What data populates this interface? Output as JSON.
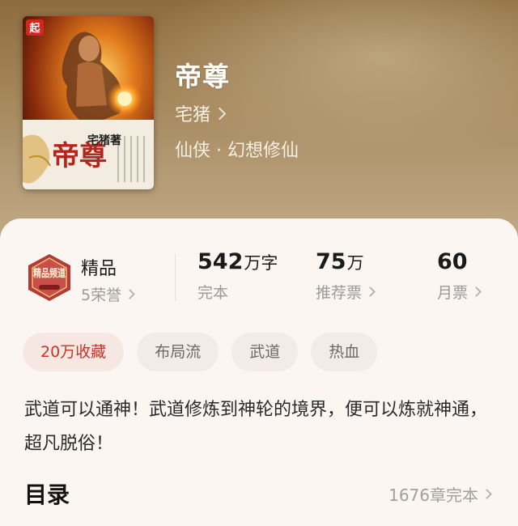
{
  "book": {
    "title": "帝尊",
    "author": "宅猪",
    "genre": "仙侠 · 幻想修仙"
  },
  "cover": {
    "publisher_logo": "起",
    "cover_title": "帝尊",
    "cover_author_line": "宅猪著"
  },
  "quality": {
    "badge_text": "精品频道",
    "title": "精品",
    "honors": "5荣誉"
  },
  "stats": {
    "words_value": "542",
    "words_unit": "万字",
    "words_label": "完本",
    "recommend_value": "75",
    "recommend_unit": "万",
    "recommend_label": "推荐票",
    "monthly_value": "60",
    "monthly_label": "月票"
  },
  "tags": [
    "20万收藏",
    "布局流",
    "武道",
    "热血"
  ],
  "description": "武道可以通神！武道修炼到神轮的境界，便可以炼就神通，超凡脱俗！",
  "toc": {
    "title": "目录",
    "chapters": "1676章完本"
  },
  "colors": {
    "accent_red": "#c8342b",
    "card_bg": "#fcf6f3",
    "hero_bg": "#a68a5e"
  }
}
